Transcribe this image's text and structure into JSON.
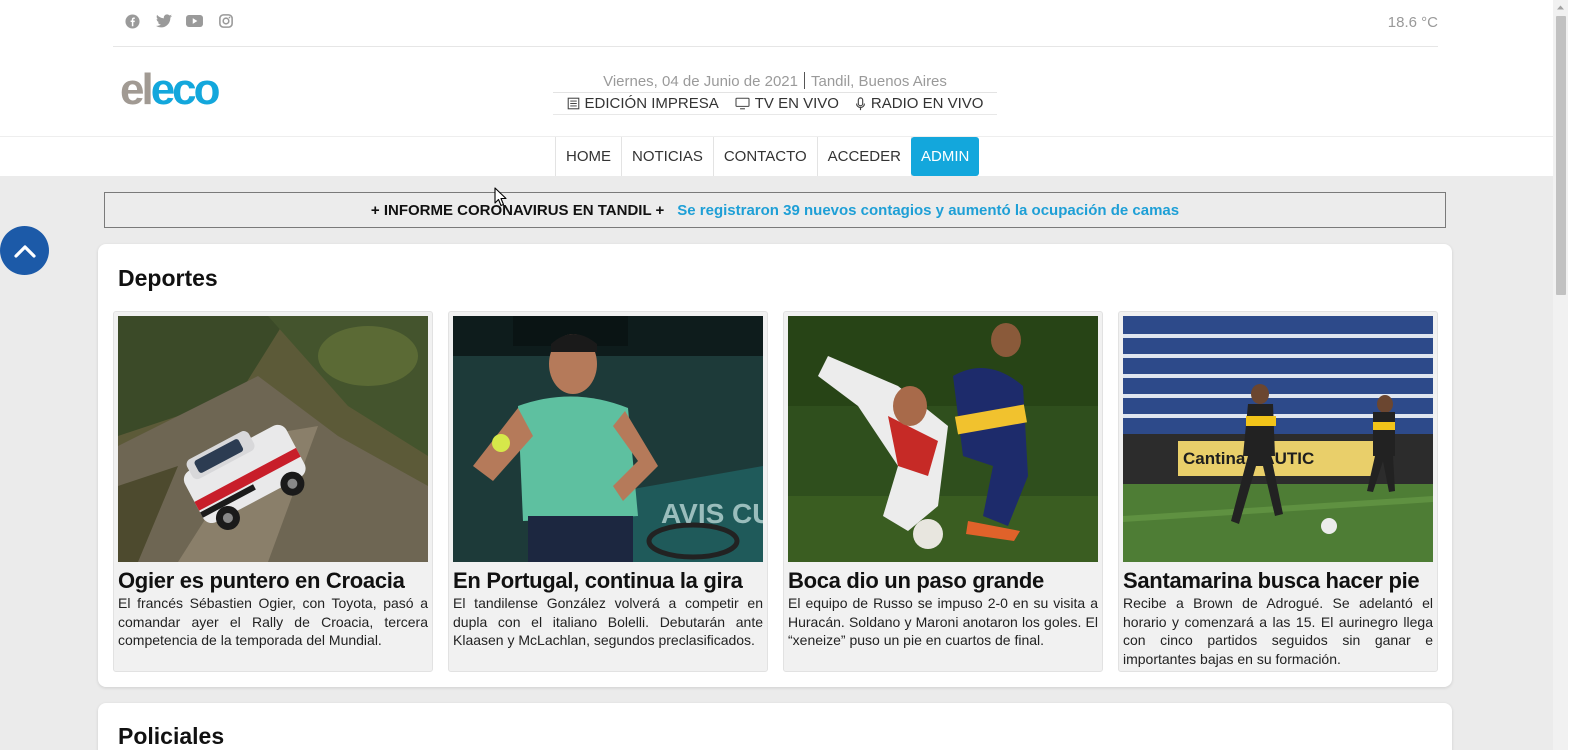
{
  "topbar": {
    "social_icons": [
      "facebook-icon",
      "twitter-icon",
      "youtube-icon",
      "instagram-icon"
    ],
    "temperature": "18.6 °C"
  },
  "logo": {
    "part1": "el",
    "part2": "eco"
  },
  "info": {
    "date": "Viernes, 04 de Junio de 2021",
    "location": "Tandil, Buenos Aires",
    "links": [
      {
        "label": "EDICIÓN IMPRESA",
        "icon": "newspaper-icon"
      },
      {
        "label": "TV EN VIVO",
        "icon": "monitor-icon"
      },
      {
        "label": "RADIO EN VIVO",
        "icon": "microphone-icon"
      }
    ]
  },
  "nav": {
    "items": [
      "HOME",
      "NOTICIAS",
      "CONTACTO",
      "ACCEDER",
      "ADMIN"
    ],
    "active": "ADMIN"
  },
  "ticker": {
    "tag": "+ INFORME CORONAVIRUS EN TANDIL +",
    "headline": "Se registraron 39 nuevos contagios y aumentó la ocupación de camas"
  },
  "sections": [
    {
      "title": "Deportes",
      "articles": [
        {
          "headline": "Ogier es puntero en Croacia",
          "summary": "El francés Sébastien Ogier, con Toyota, pasó a comandar ayer el Rally de Croacia, tercera competencia de la temporada del Mundial."
        },
        {
          "headline": "En Portugal, continua la gira",
          "summary": "El tandilense González volverá a competir en dupla con el italiano Bolelli. Debutarán ante Klaasen y McLachlan, segundos preclasificados."
        },
        {
          "headline": "Boca dio un paso grande",
          "summary": "El equipo de Russo se impuso 2-0 en su visita a Huracán. Soldano y Maroni anotaron los goles. El “xeneize” puso un pie en cuartos de final."
        },
        {
          "headline": "Santamarina busca hacer pie",
          "summary": "Recibe a Brown de Adrogué. Se adelantó el horario y comenzará a las 15. El aurinegro llega con cinco partidos seguidos sin ganar e importantes bajas en su formación."
        }
      ]
    },
    {
      "title": "Policiales"
    }
  ],
  "colors": {
    "accent": "#13a7dc",
    "logo_el": "#a19a93",
    "scroll_top_button": "#1c5aa8"
  }
}
